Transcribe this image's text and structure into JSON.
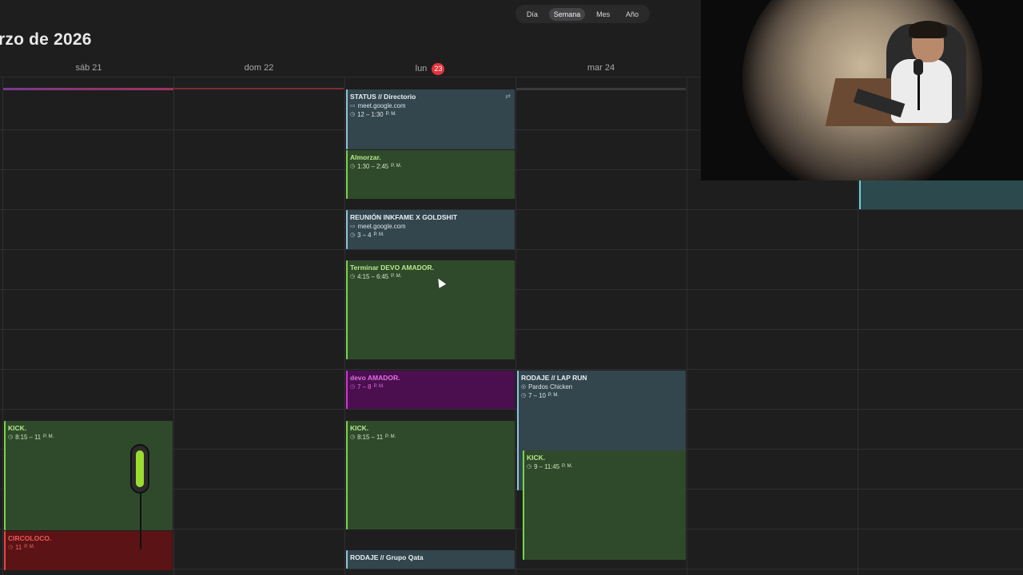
{
  "header": {
    "month_title": "rzo de 2026"
  },
  "view_switch": {
    "options": [
      "Día",
      "Semana",
      "Mes",
      "Año"
    ],
    "active": "Semana"
  },
  "days": {
    "sat": "sáb 21",
    "sun": "dom 22",
    "mon_label": "lun",
    "mon_num": "23",
    "tue": "mar 24"
  },
  "events": {
    "status": {
      "title": "STATUS // Directorio",
      "location": "meet.google.com",
      "time": "12 – 1:30",
      "ampm": "P. M."
    },
    "almorzar": {
      "title": "Almorzar.",
      "time": "1:30 – 2:45",
      "ampm": "P. M."
    },
    "reunion": {
      "title": "REUNIÓN INKFAME X GOLDSHIT",
      "location": "meet.google.com",
      "time": "3 – 4",
      "ampm": "P. M."
    },
    "terminar": {
      "title": "Terminar DEVO AMADOR.",
      "time": "4:15 – 6:45",
      "ampm": "P. M."
    },
    "devo": {
      "title": "devo AMADOR.",
      "time": "7 – 8",
      "ampm": "P. M."
    },
    "kick_mon": {
      "title": "KICK.",
      "time": "8:15 – 11",
      "ampm": "P. M."
    },
    "rodaje_grupo": {
      "title": "RODAJE // Grupo Qata"
    },
    "kick_sat": {
      "title": "KICK.",
      "time": "8:15 – 11",
      "ampm": "P. M."
    },
    "circoloco": {
      "title": "CIRCOLOCO.",
      "time": "11",
      "ampm": "P. M."
    },
    "rodaje_lap": {
      "title": "RODAJE // LAP RUN",
      "location": "Pardos Chicken",
      "time": "7 – 10",
      "ampm": "P. M."
    },
    "kick_tue": {
      "title": "KICK.",
      "time": "9 – 11:45",
      "ampm": "P. M."
    }
  },
  "colors": {
    "blue_event": "#33454d",
    "green_event": "#2f4a2a",
    "purple_event": "#4b0f4f",
    "red_event": "#5b1315",
    "today_badge": "#e5333b"
  }
}
